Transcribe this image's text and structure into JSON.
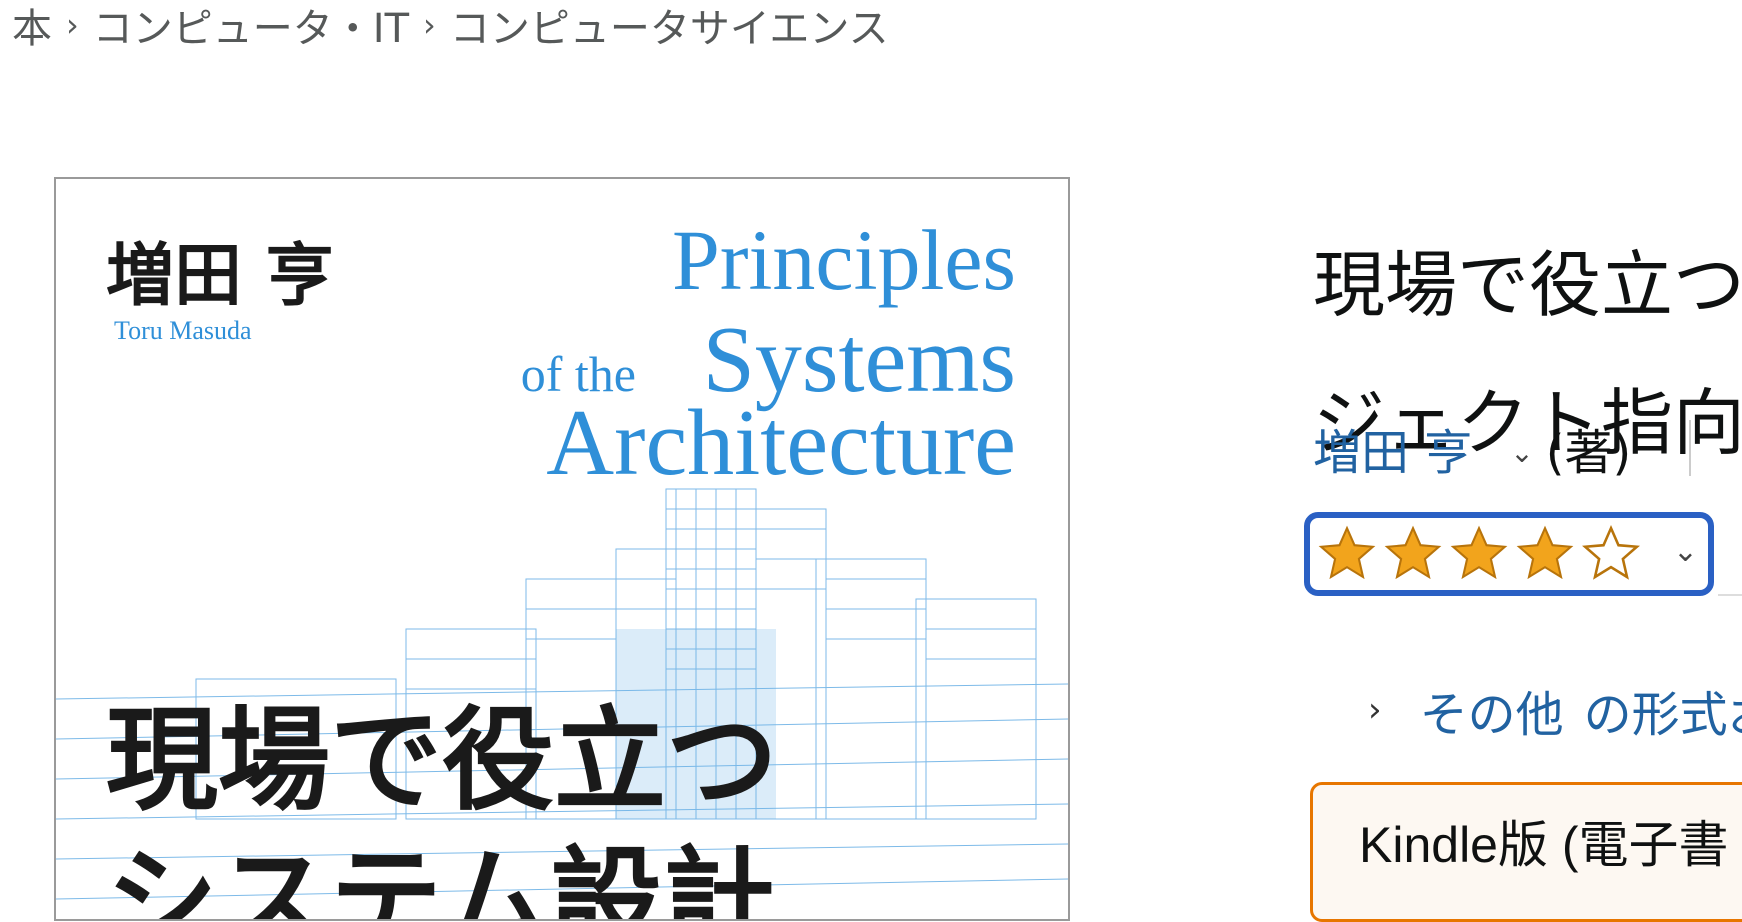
{
  "breadcrumb": {
    "items": [
      "本",
      "コンピュータ・IT",
      "コンピュータサイエンス"
    ],
    "separator": "›"
  },
  "cover": {
    "author_jp": "増田 亨",
    "author_en": "Toru Masuda",
    "en_title_line1": "Principles",
    "en_title_of_the": "of the",
    "en_title_line2": "Systems",
    "en_title_line3": "Architecture",
    "jp_title_line1": "現場で役立つ",
    "jp_title_line2": "システム設計",
    "accent_color": "#2f8fd8"
  },
  "product": {
    "title_line1": "現場で役立つ",
    "title_line2": "ジェクト指向",
    "author": "増田 亨",
    "role": "(著)",
    "rating_stars_filled": 4,
    "rating_stars_total": 5,
    "other_formats_prefix": "その他",
    "other_formats_rest": "の形式お",
    "format_card_label": "Kindle版 (電子書"
  },
  "icons": {
    "chevron_down": "⌄",
    "chevron_right": "›"
  }
}
